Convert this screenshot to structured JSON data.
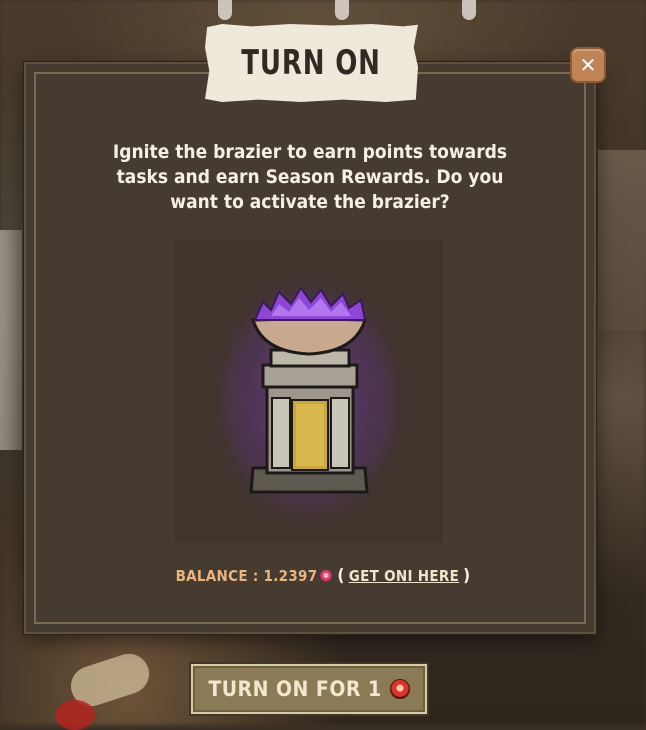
{
  "dialog": {
    "title": "TURN ON",
    "description": "Ignite the brazier to earn points towards tasks and earn Season Rewards. Do you want to activate the brazier?",
    "close_symbol": "✕",
    "item_icon": "brazier-icon"
  },
  "balance": {
    "label": "BALANCE : 1.2397",
    "currency_icon": "oni-token-icon",
    "open_paren": "(",
    "link_text": "GET ONI HERE",
    "close_paren": ")"
  },
  "action_button": {
    "label": "TURN ON FOR 1",
    "currency_icon": "oni-token-icon"
  },
  "colors": {
    "panel": "#463b30",
    "accent_orange": "#e9b47f",
    "close_button": "#c08356",
    "brazier_glow": "#8f45d6"
  }
}
